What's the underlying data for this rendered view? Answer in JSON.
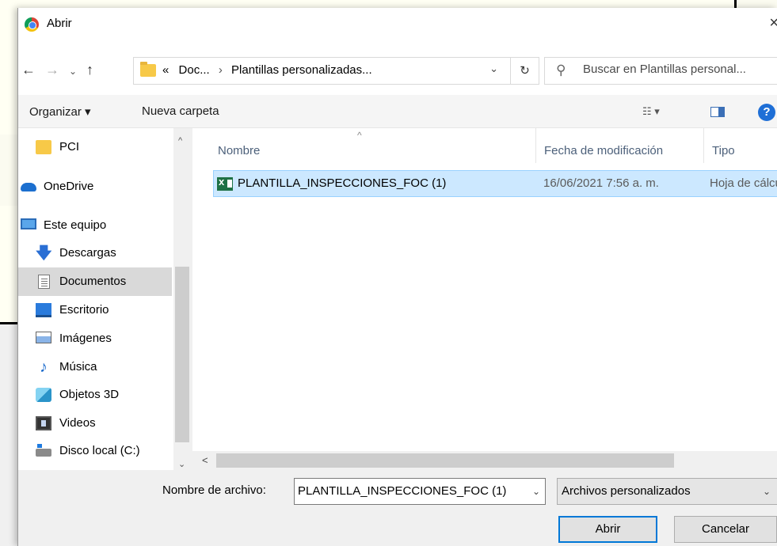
{
  "window": {
    "title": "Abrir",
    "close_glyph": "×"
  },
  "nav": {
    "back_glyph": "←",
    "forward_glyph": "→",
    "recent_glyph": "⌄",
    "up_glyph": "↑",
    "breadcrumb": [
      "«",
      "Doc...",
      "›",
      "Plantillas personalizadas..."
    ],
    "address_dropdown_glyph": "⌄",
    "refresh_glyph": "↻",
    "search_placeholder": "Buscar en Plantillas personal..."
  },
  "toolbar": {
    "organize_label": "Organizar ▾",
    "new_folder_label": "Nueva carpeta",
    "views_glyph": "☷ ▾",
    "help_glyph": "?"
  },
  "sidebar": {
    "items": [
      {
        "label": "PCI",
        "icon": "folder-icon"
      },
      {
        "label": "OneDrive",
        "icon": "onedrive-cloud-icon"
      },
      {
        "label": "Este equipo",
        "icon": "computer-icon"
      },
      {
        "label": "Descargas",
        "icon": "downloads-arrow-icon"
      },
      {
        "label": "Documentos",
        "icon": "documents-icon",
        "active": true
      },
      {
        "label": "Escritorio",
        "icon": "desktop-icon"
      },
      {
        "label": "Imágenes",
        "icon": "pictures-icon"
      },
      {
        "label": "Música",
        "icon": "music-note-icon"
      },
      {
        "label": "Objetos 3D",
        "icon": "objects-3d-icon"
      },
      {
        "label": "Videos",
        "icon": "video-film-icon"
      },
      {
        "label": "Disco local (C:)",
        "icon": "local-disk-icon"
      }
    ],
    "music_glyph": "♪",
    "download_glyph": "🡇"
  },
  "filelist": {
    "columns": [
      "Nombre",
      "Fecha de modificación",
      "Tipo"
    ],
    "sort_glyph": "^",
    "files": [
      {
        "name": "PLANTILLA_INSPECCIONES_FOC (1)",
        "modified": "16/06/2021 7:56 a. m.",
        "type": "Hoja de cálcu",
        "icon": "excel-file-icon",
        "selected": true
      }
    ]
  },
  "scroll": {
    "up": "^",
    "down": "⌄",
    "left": "<"
  },
  "bottom": {
    "filename_label": "Nombre de archivo:",
    "filename_value": "PLANTILLA_INSPECCIONES_FOC (1)",
    "filename_dropdown_glyph": "⌄",
    "filetype_value": "Archivos personalizados",
    "filetype_dropdown_glyph": "⌄",
    "open_label": "Abrir",
    "cancel_label": "Cancelar"
  },
  "colors": {
    "selection_bg": "#cce8ff",
    "selection_border": "#99d1ff",
    "primary_button_border": "#0078d7",
    "folder_yellow": "#f7c948",
    "excel_green": "#1e7145"
  }
}
